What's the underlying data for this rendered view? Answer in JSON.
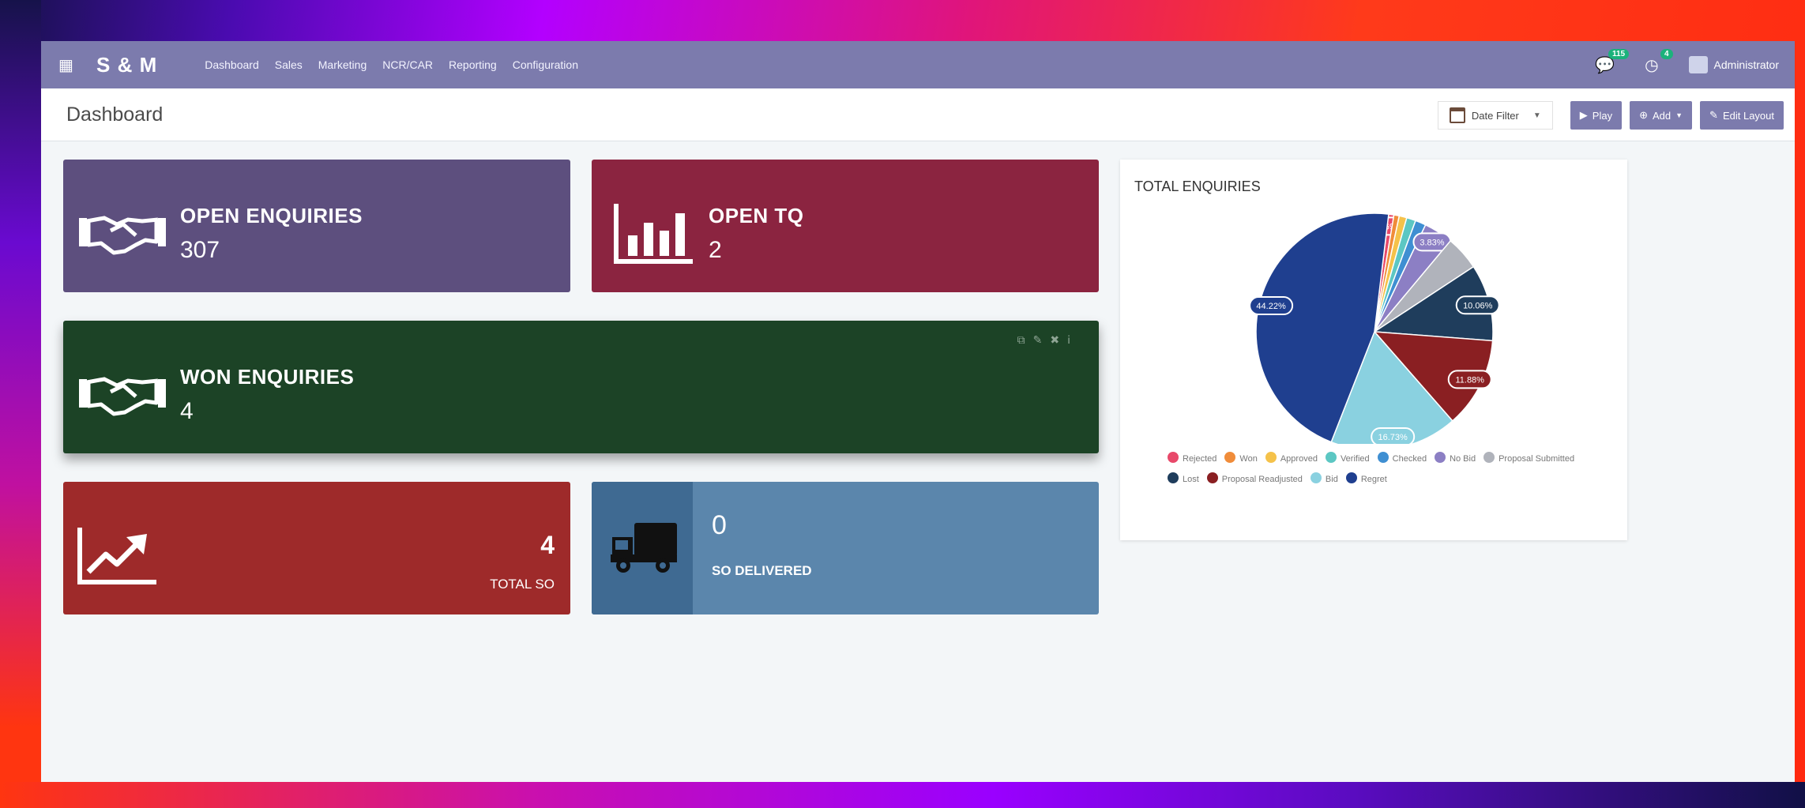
{
  "navbar": {
    "apps_icon": "apps-grid-icon",
    "brand": "S & M",
    "menu": [
      "Dashboard",
      "Sales",
      "Marketing",
      "NCR/CAR",
      "Reporting",
      "Configuration"
    ],
    "messages_count": "115",
    "activities_count": "4",
    "user": "Administrator"
  },
  "control": {
    "title": "Dashboard",
    "date_filter": "Date Filter",
    "play": "Play",
    "add": "Add",
    "edit_layout": "Edit Layout"
  },
  "tiles": {
    "open_enquiries": {
      "title": "OPEN ENQUIRIES",
      "value": "307",
      "icon": "handshake-icon",
      "color": "#5d4f7e"
    },
    "open_tq": {
      "title": "OPEN TQ",
      "value": "2",
      "icon": "bar-chart-icon",
      "color": "#8b2440"
    },
    "won_enquiries": {
      "title": "WON ENQUIRIES",
      "value": "4",
      "icon": "handshake-icon",
      "color": "#1c4326"
    },
    "total_so": {
      "title": "TOTAL SO",
      "value": "4",
      "icon": "trend-up-icon",
      "color": "#9e2a2a"
    },
    "so_delivered": {
      "title": "SO DELIVERED",
      "value": "0",
      "icon": "truck-icon",
      "color": "#5b86ac"
    }
  },
  "chart_data": {
    "type": "pie",
    "title": "TOTAL ENQUIRIES",
    "labels": [
      "Rejected",
      "Won",
      "Approved",
      "Verified",
      "Checked",
      "No Bid",
      "Proposal Submitted",
      "Lost",
      "Proposal Readjusted",
      "Bid",
      "Regret"
    ],
    "values": [
      0.69,
      0.7,
      1.0,
      1.2,
      1.4,
      3.83,
      4.5,
      10.06,
      11.88,
      16.73,
      44.22
    ],
    "value_labels": [
      "0.69%",
      "",
      "",
      "",
      "",
      "3.83%",
      "",
      "10.06%",
      "11.88%",
      "16.73%",
      "44.22%"
    ],
    "colors": [
      "#e8496a",
      "#f08c3a",
      "#f5c24a",
      "#5cc7c3",
      "#3f8fd2",
      "#8c7fc4",
      "#b0b3bb",
      "#1f3d5c",
      "#8a1f22",
      "#8ad1e0",
      "#1f3f8f"
    ],
    "legend_position": "bottom"
  }
}
